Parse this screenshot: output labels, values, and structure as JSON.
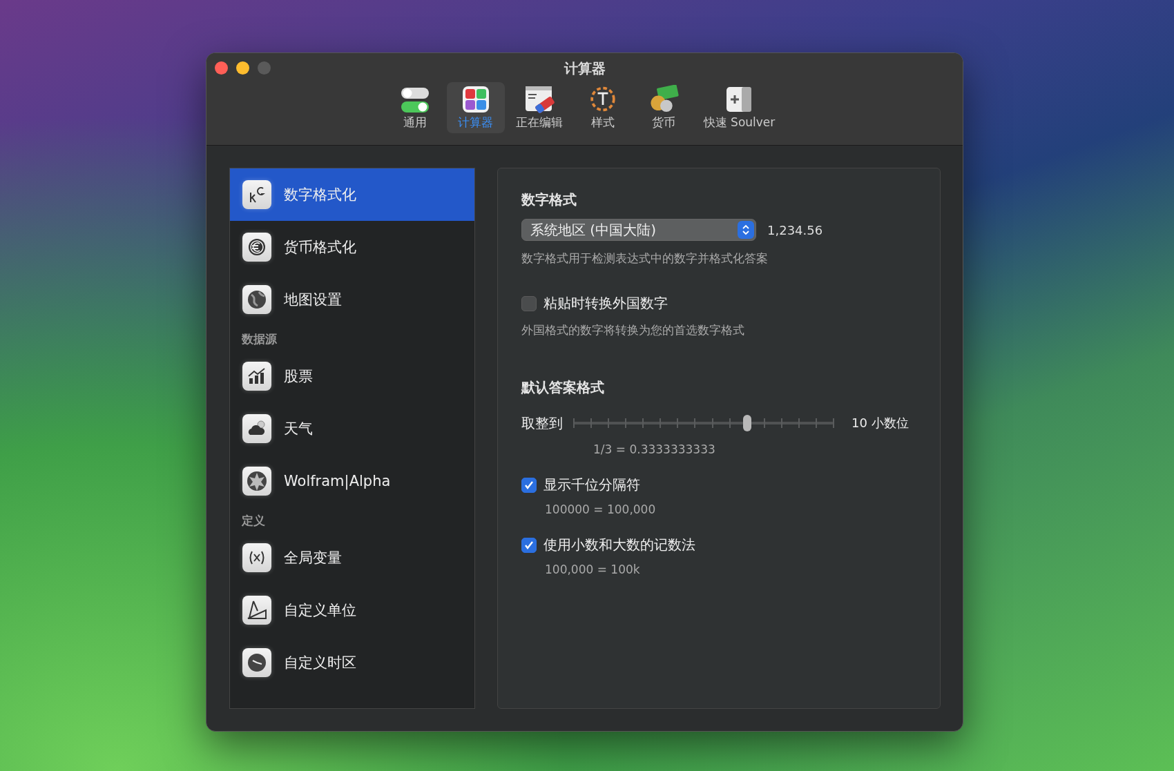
{
  "window": {
    "title": "计算器"
  },
  "toolbar": {
    "tabs": [
      {
        "label": "通用",
        "selected": false
      },
      {
        "label": "计算器",
        "selected": true
      },
      {
        "label": "正在编辑",
        "selected": false
      },
      {
        "label": "样式",
        "selected": false
      },
      {
        "label": "货币",
        "selected": false
      },
      {
        "label": "快速 Soulver",
        "selected": false
      }
    ]
  },
  "sidebar": {
    "items": [
      {
        "kind": "item",
        "label": "数字格式化",
        "selected": true
      },
      {
        "kind": "item",
        "label": "货币格式化",
        "selected": false
      },
      {
        "kind": "item",
        "label": "地图设置",
        "selected": false
      },
      {
        "kind": "section",
        "label": "数据源"
      },
      {
        "kind": "item",
        "label": "股票",
        "selected": false
      },
      {
        "kind": "item",
        "label": "天气",
        "selected": false
      },
      {
        "kind": "item",
        "label": "Wolfram|Alpha",
        "selected": false
      },
      {
        "kind": "section",
        "label": "定义"
      },
      {
        "kind": "item",
        "label": "全局变量",
        "selected": false
      },
      {
        "kind": "item",
        "label": "自定义单位",
        "selected": false
      },
      {
        "kind": "item",
        "label": "自定义时区",
        "selected": false
      }
    ]
  },
  "number_format": {
    "heading": "数字格式",
    "popup": {
      "value": "系统地区 (中国大陆)"
    },
    "preview": "1,234.56",
    "description": "数字格式用于检测表达式中的数字并格式化答案"
  },
  "paste_convert": {
    "label": "粘贴时转换外国数字",
    "checked": false,
    "description": "外国格式的数字将转换为您的首选数字格式"
  },
  "default_format": {
    "heading": "默认答案格式",
    "rounding": {
      "label": "取整到",
      "level": 0.667,
      "reading": "10 小数位",
      "example": "1/3 = 0.3333333333"
    },
    "options": [
      {
        "label": "显示千位分隔符",
        "checked": true,
        "example": "100000 = 100,000"
      },
      {
        "label": "使用小数和大数的记数法",
        "checked": true,
        "example": "100,000 = 100k"
      }
    ]
  }
}
